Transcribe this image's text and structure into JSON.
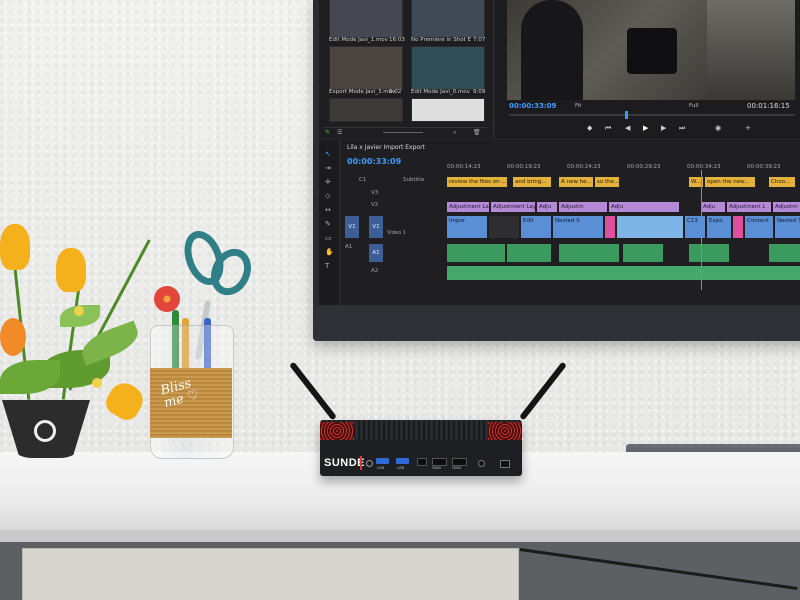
{
  "screen": {
    "bin": {
      "clips": [
        {
          "name": "Edit Mode Javi_1.mov",
          "duration": "16:03"
        },
        {
          "name": "No Premiere in Shot Edit...",
          "duration": "7:07"
        },
        {
          "name": "Export Mode Javi_3.mov",
          "duration": "6:02"
        },
        {
          "name": "Edit Mode Javi_0.mov",
          "duration": "9:09"
        }
      ]
    },
    "program_monitor": {
      "current_timecode": "00:00:33:09",
      "fit_label": "Fit",
      "quality_label": "Full",
      "duration_timecode": "00:01:16:15"
    },
    "timeline": {
      "sequence_name": "Lila x Javier Import Export",
      "current_timecode": "00:00:33:09",
      "ruler": [
        "00:00:14:23",
        "00:00:19:23",
        "00:00:24:23",
        "00:00:29:23",
        "00:00:34:23",
        "00:00:39:23"
      ],
      "tracks": {
        "subtitle_label": "Subtitle",
        "v3": "V3",
        "v2": "V2",
        "v1": "V1",
        "v1_source": "V1",
        "video1_name": "Video 1",
        "a1": "A1",
        "a1_source": "A1",
        "a2": "A2",
        "c1": "C1"
      },
      "subtitle_clips": [
        "review the files on ...",
        "and bring...",
        "A new he...",
        "so the...",
        "W...",
        "open the new...",
        "Choo..."
      ],
      "adjustment_clips": [
        "Adjustment La",
        "Adjustment Lay",
        "Adju",
        "Adjustm",
        "Adju",
        "Adju",
        "Adjustment L",
        "Adjustm"
      ],
      "video_clips": [
        "Impor",
        "Edit",
        "Nested S",
        "C13",
        "Expo",
        "Content",
        "Nested S"
      ]
    }
  },
  "mini_pc": {
    "brand": "SUNDE",
    "ports": [
      "USB",
      "USB",
      "",
      "HDMI",
      "HDMI"
    ]
  },
  "jar_label": "Bliss\nme ♡",
  "colors": {
    "premiere_blue": "#3b9cff",
    "subtitle_clip": "#e3b23c",
    "adjustment_clip": "#b48ad6",
    "video_clip": "#5a8fd6",
    "audio_clip": "#3b9b5e",
    "pc_accent_red": "#c9302c",
    "usb_blue": "#2f6bd8",
    "burlap": "#c99a4e",
    "scissor_teal": "#2f7f86",
    "tulip_yellow": "#f4b11c"
  }
}
